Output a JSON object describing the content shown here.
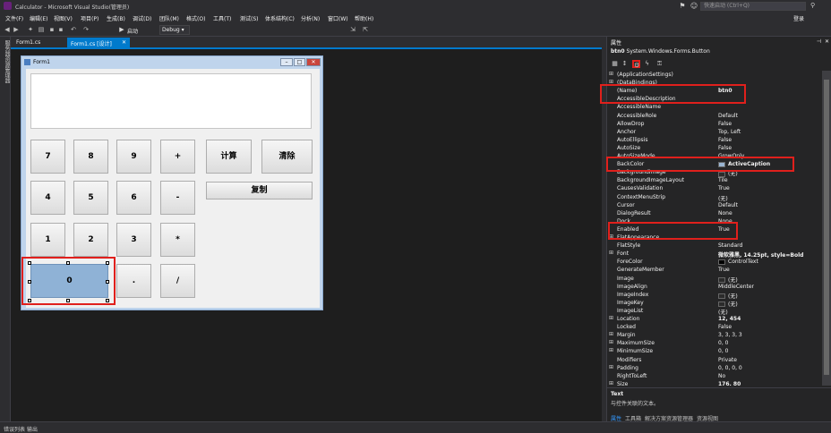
{
  "window": {
    "title": "Calculator - Microsoft Visual Studio(管理员)",
    "quick_launch_placeholder": "快速启动 (Ctrl+Q)",
    "login": "登录"
  },
  "menu": [
    "文件(F)",
    "编辑(E)",
    "视图(V)",
    "项目(P)",
    "生成(B)",
    "调试(D)",
    "团队(M)",
    "格式(O)",
    "工具(T)",
    "测试(S)",
    "体系结构(C)",
    "分析(N)",
    "窗口(W)",
    "帮助(H)"
  ],
  "toolbar": {
    "start_label": "启动",
    "config": "Debug"
  },
  "left_strip_label": "服务器资源管理器",
  "tabs": {
    "form1cs": "Form1.cs",
    "design": "Form1.cs [设计]"
  },
  "form": {
    "title": "Form1",
    "buttons": {
      "b7": "7",
      "b8": "8",
      "b9": "9",
      "plus": "+",
      "calc": "计算",
      "clear": "清除",
      "b4": "4",
      "b5": "5",
      "b6": "6",
      "minus": "-",
      "copy": "复制",
      "b1": "1",
      "b2": "2",
      "b3": "3",
      "mult": "*",
      "b0": "0",
      "dot": ".",
      "div": "/"
    }
  },
  "props": {
    "header": "属性",
    "object_name": "btn0",
    "object_type": "System.Windows.Forms.Button",
    "rows": [
      {
        "name": "(ApplicationSettings)",
        "value": "",
        "exp": "⊞"
      },
      {
        "name": "(DataBindings)",
        "value": "",
        "exp": "⊞"
      },
      {
        "name": "(Name)",
        "value": "btn0",
        "exp": "",
        "bold": true
      },
      {
        "name": "AccessibleDescription",
        "value": "",
        "exp": ""
      },
      {
        "name": "AccessibleName",
        "value": "",
        "exp": ""
      },
      {
        "name": "AccessibleRole",
        "value": "Default",
        "exp": ""
      },
      {
        "name": "AllowDrop",
        "value": "False",
        "exp": ""
      },
      {
        "name": "Anchor",
        "value": "Top, Left",
        "exp": ""
      },
      {
        "name": "AutoEllipsis",
        "value": "False",
        "exp": ""
      },
      {
        "name": "AutoSize",
        "value": "False",
        "exp": ""
      },
      {
        "name": "AutoSizeMode",
        "value": "GrowOnly",
        "exp": ""
      },
      {
        "name": "BackColor",
        "value": "ActiveCaption",
        "exp": "",
        "bold": true,
        "swatch": "#99b4d1"
      },
      {
        "name": "BackgroundImage",
        "value": "(无)",
        "exp": "",
        "swatch": "#2b2b2b"
      },
      {
        "name": "BackgroundImageLayout",
        "value": "Tile",
        "exp": ""
      },
      {
        "name": "CausesValidation",
        "value": "True",
        "exp": ""
      },
      {
        "name": "ContextMenuStrip",
        "value": "(无)",
        "exp": ""
      },
      {
        "name": "Cursor",
        "value": "Default",
        "exp": ""
      },
      {
        "name": "DialogResult",
        "value": "None",
        "exp": ""
      },
      {
        "name": "Dock",
        "value": "None",
        "exp": ""
      },
      {
        "name": "Enabled",
        "value": "True",
        "exp": ""
      },
      {
        "name": "FlatAppearance",
        "value": "",
        "exp": "⊞"
      },
      {
        "name": "FlatStyle",
        "value": "Standard",
        "exp": ""
      },
      {
        "name": "Font",
        "value": "微软雅黑, 14.25pt, style=Bold",
        "exp": "⊞",
        "bold": true
      },
      {
        "name": "ForeColor",
        "value": "ControlText",
        "exp": "",
        "swatch": "#000000"
      },
      {
        "name": "GenerateMember",
        "value": "True",
        "exp": ""
      },
      {
        "name": "Image",
        "value": "(无)",
        "exp": "",
        "swatch": "#2b2b2b"
      },
      {
        "name": "ImageAlign",
        "value": "MiddleCenter",
        "exp": ""
      },
      {
        "name": "ImageIndex",
        "value": "(无)",
        "exp": "",
        "swatch": "#2b2b2b"
      },
      {
        "name": "ImageKey",
        "value": "(无)",
        "exp": "",
        "swatch": "#2b2b2b"
      },
      {
        "name": "ImageList",
        "value": "(无)",
        "exp": ""
      },
      {
        "name": "Location",
        "value": "12, 454",
        "exp": "⊞",
        "bold": true
      },
      {
        "name": "Locked",
        "value": "False",
        "exp": ""
      },
      {
        "name": "Margin",
        "value": "3, 3, 3, 3",
        "exp": "⊞"
      },
      {
        "name": "MaximumSize",
        "value": "0, 0",
        "exp": "⊞"
      },
      {
        "name": "MinimumSize",
        "value": "0, 0",
        "exp": "⊞"
      },
      {
        "name": "Modifiers",
        "value": "Private",
        "exp": ""
      },
      {
        "name": "Padding",
        "value": "0, 0, 0, 0",
        "exp": "⊞"
      },
      {
        "name": "RightToLeft",
        "value": "No",
        "exp": ""
      },
      {
        "name": "Size",
        "value": "176, 80",
        "exp": "⊞",
        "bold": true
      }
    ],
    "desc_title": "Text",
    "desc_text": "与控件关联的文本。",
    "bottom_tabs": [
      "属性",
      "工具箱",
      "解决方案资源管理器",
      "资源视图"
    ]
  },
  "statusbar": {
    "items": [
      "错误列表",
      "输出"
    ]
  },
  "colors": {
    "accent": "#007acc",
    "highlight": "#e0201c",
    "btn0_back": "#8fb2d6"
  }
}
